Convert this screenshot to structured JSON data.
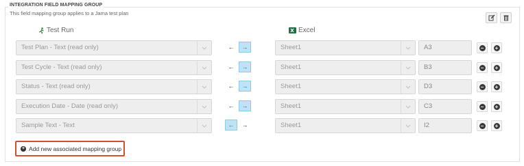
{
  "group": {
    "legend": "INTEGRATION FIELD MAPPING GROUP",
    "description": "This field mapping group applies to a Jama test plan"
  },
  "toolbar": {
    "edit_icon": "edit-icon",
    "delete_icon": "trash-icon"
  },
  "columns": {
    "left": "Test Run",
    "right": "Excel"
  },
  "rows": [
    {
      "field": "Test Plan - Text (read only)",
      "direction": "right",
      "sheet": "Sheet1",
      "cell": "A3"
    },
    {
      "field": "Test Cycle - Text (read only)",
      "direction": "right",
      "sheet": "Sheet1",
      "cell": "B3"
    },
    {
      "field": "Status - Text (read only)",
      "direction": "right",
      "sheet": "Sheet1",
      "cell": "D3"
    },
    {
      "field": "Execution Date - Date (read only)",
      "direction": "right",
      "sheet": "Sheet1",
      "cell": "C3"
    },
    {
      "field": "Sample Text - Text",
      "direction": "left",
      "sheet": "Sheet1",
      "cell": "I2"
    }
  ],
  "arrows": {
    "left": "←",
    "right": "→"
  },
  "row_buttons": {
    "remove": "−",
    "add": "+"
  },
  "add_group": {
    "label": "Add new associated mapping group"
  },
  "colors": {
    "highlight_border": "#d4502a",
    "active_arrow": "#bfe2f5"
  }
}
